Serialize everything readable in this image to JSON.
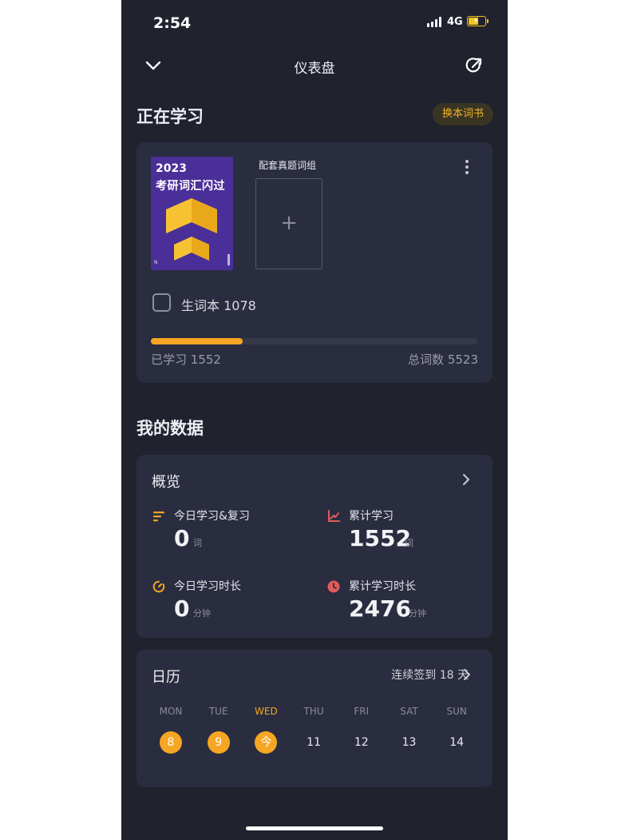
{
  "status_bar": {
    "time": "2:54",
    "network": "4G"
  },
  "nav": {
    "title": "仪表盘",
    "back_icon": "chevron-down-icon",
    "share_icon": "share-icon"
  },
  "studying": {
    "title": "正在学习",
    "change_book_label": "换本词书",
    "book": {
      "cover_year": "2023",
      "cover_title": "考研词汇闪过",
      "cover_publisher_mark": "N"
    },
    "related_label": "配套真题词组",
    "add_label": "+",
    "vocab_book_label": "生词本 1078",
    "learned_label": "已学习 1552",
    "total_label": "总词数 5523",
    "progress": 0.281
  },
  "my_data": {
    "title": "我的数据",
    "overview": {
      "title": "概览",
      "stats": [
        {
          "label": "今日学习&复习",
          "value": "0",
          "unit": "词",
          "icon": "list-icon",
          "color": "#f5a623"
        },
        {
          "label": "累计学习",
          "value": "1552",
          "unit": "词",
          "icon": "line-chart-icon",
          "color": "#e25a5a"
        },
        {
          "label": "今日学习时长",
          "value": "0",
          "unit": "分钟",
          "icon": "timer-icon",
          "color": "#f5a623"
        },
        {
          "label": "累计学习时长",
          "value": "2476",
          "unit": "分钟",
          "icon": "clock-icon",
          "color": "#e25a5a"
        }
      ]
    },
    "calendar": {
      "title": "日历",
      "streak_label": "连续签到 18 天",
      "weekdays": [
        "MON",
        "TUE",
        "WED",
        "THU",
        "FRI",
        "SAT",
        "SUN"
      ],
      "days": [
        "8",
        "9",
        "今",
        "11",
        "12",
        "13",
        "14"
      ],
      "active_weekday_index": 2,
      "completed_days": [
        0,
        1,
        2
      ]
    }
  },
  "colors": {
    "background": "#20222e",
    "card": "#2a2d3f",
    "accent": "#f5a623",
    "red": "#e25a5a"
  }
}
